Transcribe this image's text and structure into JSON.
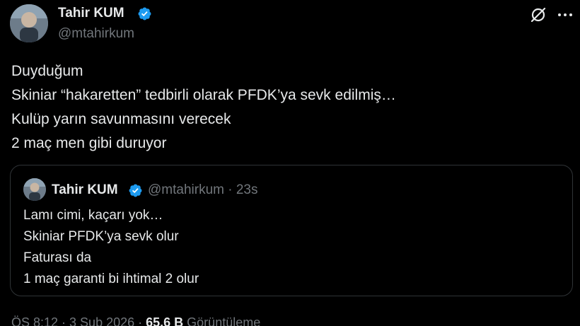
{
  "author": {
    "display_name": "Tahir KUM",
    "handle": "@mtahirkum",
    "verified": true
  },
  "tweet": {
    "lines": [
      "Duyduğum",
      "Skiniar “hakaretten” tedbirli olarak PFDK’ya sevk edilmiş…",
      "Kulüp yarın savunmasını verecek",
      "2 maç men gibi duruyor"
    ]
  },
  "quoted": {
    "display_name": "Tahir KUM",
    "meta": "@mtahirkum · 23s",
    "lines": [
      "Lamı cimi, kaçarı yok…",
      "Skiniar PFDK’ya sevk olur",
      "Faturası da",
      "1 maç garanti bi ihtimal 2 olur"
    ]
  },
  "footer": {
    "timestamp": "ÖS 8:12 · 3 Şub 2026 · ",
    "views_count": "65,6 B",
    "views_label": " Görüntüleme"
  },
  "icons": {
    "verified": "verified-badge-icon",
    "grok": "grok-icon",
    "more": "more-icon"
  },
  "colors": {
    "background": "#000000",
    "text": "#e7e9ea",
    "secondary": "#71767b",
    "verified": "#1d9bf0",
    "border": "#2f3336"
  }
}
